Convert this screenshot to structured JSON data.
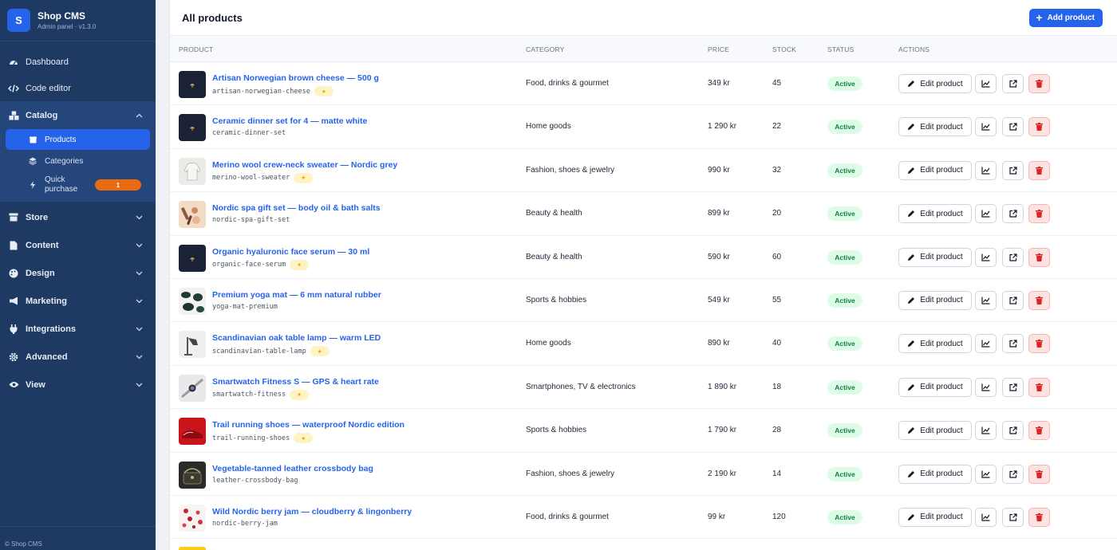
{
  "brand": {
    "logo_letter": "S",
    "name": "Shop CMS",
    "subtitle": "Admin panel · v1.3.0"
  },
  "sidebar": {
    "dashboard": "Dashboard",
    "code_editor": "Code editor",
    "catalog": "Catalog",
    "products": "Products",
    "categories": "Categories",
    "quick_purchase": "Quick purchase",
    "quick_purchase_count": "1",
    "store": "Store",
    "content": "Content",
    "design": "Design",
    "marketing": "Marketing",
    "integrations": "Integrations",
    "advanced": "Advanced",
    "view": "View",
    "footer": "© Shop CMS"
  },
  "header": {
    "title": "All products",
    "add_button": "Add product"
  },
  "columns": {
    "product": "Product",
    "category": "Category",
    "price": "Price",
    "stock": "Stock",
    "status": "Status",
    "actions": "Actions"
  },
  "actions": {
    "edit_label": "Edit product"
  },
  "products": [
    {
      "name": "Artisan Norwegian brown cheese — 500 g",
      "slug": "artisan-norwegian-cheese",
      "featured": true,
      "category": "Food, drinks & gourmet",
      "price": "349 kr",
      "stock": "45",
      "status": "Active",
      "thumb": "dark"
    },
    {
      "name": "Ceramic dinner set for 4 — matte white",
      "slug": "ceramic-dinner-set",
      "featured": false,
      "category": "Home goods",
      "price": "1 290 kr",
      "stock": "22",
      "status": "Active",
      "thumb": "dark"
    },
    {
      "name": "Merino wool crew-neck sweater — Nordic grey",
      "slug": "merino-wool-sweater",
      "featured": true,
      "category": "Fashion, shoes & jewelry",
      "price": "990 kr",
      "stock": "32",
      "status": "Active",
      "thumb": "sweater"
    },
    {
      "name": "Nordic spa gift set — body oil & bath salts",
      "slug": "nordic-spa-gift-set",
      "featured": false,
      "category": "Beauty & health",
      "price": "899 kr",
      "stock": "20",
      "status": "Active",
      "thumb": "spa"
    },
    {
      "name": "Organic hyaluronic face serum — 30 ml",
      "slug": "organic-face-serum",
      "featured": true,
      "category": "Beauty & health",
      "price": "590 kr",
      "stock": "60",
      "status": "Active",
      "thumb": "dark"
    },
    {
      "name": "Premium yoga mat — 6 mm natural rubber",
      "slug": "yoga-mat-premium",
      "featured": false,
      "category": "Sports & hobbies",
      "price": "549 kr",
      "stock": "55",
      "status": "Active",
      "thumb": "mat"
    },
    {
      "name": "Scandinavian oak table lamp — warm LED",
      "slug": "scandinavian-table-lamp",
      "featured": true,
      "category": "Home goods",
      "price": "890 kr",
      "stock": "40",
      "status": "Active",
      "thumb": "lamp"
    },
    {
      "name": "Smartwatch Fitness S — GPS & heart rate",
      "slug": "smartwatch-fitness",
      "featured": true,
      "category": "Smartphones, TV & electronics",
      "price": "1 890 kr",
      "stock": "18",
      "status": "Active",
      "thumb": "watch"
    },
    {
      "name": "Trail running shoes — waterproof Nordic edition",
      "slug": "trail-running-shoes",
      "featured": true,
      "category": "Sports & hobbies",
      "price": "1 790 kr",
      "stock": "28",
      "status": "Active",
      "thumb": "shoe"
    },
    {
      "name": "Vegetable-tanned leather crossbody bag",
      "slug": "leather-crossbody-bag",
      "featured": false,
      "category": "Fashion, shoes & jewelry",
      "price": "2 190 kr",
      "stock": "14",
      "status": "Active",
      "thumb": "bag"
    },
    {
      "name": "Wild Nordic berry jam — cloudberry & lingonberry",
      "slug": "nordic-berry-jam",
      "featured": false,
      "category": "Food, drinks & gourmet",
      "price": "99 kr",
      "stock": "120",
      "status": "Active",
      "thumb": "jam"
    }
  ],
  "colors": {
    "sidebar_bg": "#1e3a63",
    "accent": "#2563eb",
    "quick_badge": "#ea6a12",
    "status_active_bg": "#dcfce7",
    "status_active_text": "#15803d",
    "delete_bg": "#fde2e2"
  }
}
